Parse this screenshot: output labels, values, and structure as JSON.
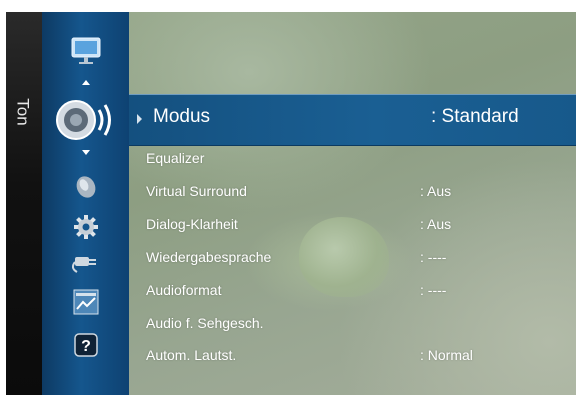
{
  "sidebar_title": "Ton",
  "menu": {
    "selected": {
      "label": "Modus",
      "value": ": Standard"
    },
    "items": [
      {
        "label": "Equalizer",
        "value": ""
      },
      {
        "label": "Virtual Surround",
        "value": ": Aus"
      },
      {
        "label": "Dialog-Klarheit",
        "value": ": Aus"
      },
      {
        "label": "Wiedergabesprache",
        "value": ": ----"
      },
      {
        "label": "Audioformat",
        "value": ": ----"
      },
      {
        "label": "Audio f. Sehgesch.",
        "value": ""
      },
      {
        "label": "Autom. Lautst.",
        "value": ": Normal"
      }
    ]
  },
  "nav_icons": [
    "picture-icon",
    "sound-icon",
    "channel-icon",
    "setup-icon",
    "input-icon",
    "application-icon",
    "support-icon"
  ],
  "colors": {
    "nav_blue": "#15568d",
    "highlight": "#1a5f93"
  }
}
